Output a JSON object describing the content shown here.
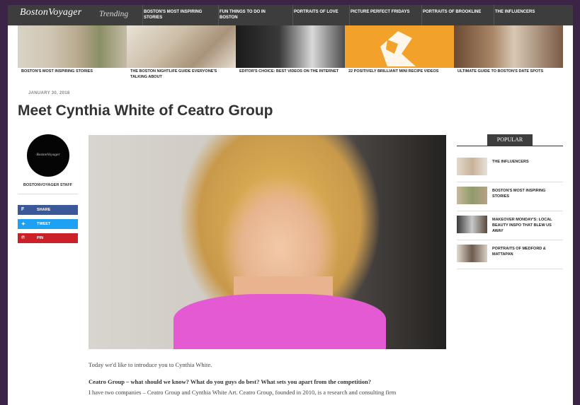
{
  "header": {
    "logo": "BostonVoyager",
    "trending_label": "Trending",
    "nav": [
      "BOSTON'S MOST INSPIRING STORIES",
      "FUN THINGS TO DO IN BOSTON",
      "PORTRAITS OF LOVE",
      "PICTURE PERFECT FRIDAYS",
      "PORTRAITS OF BROOKLINE",
      "THE INFLUENCERS"
    ]
  },
  "featured": [
    {
      "caption": "BOSTON'S MOST INSPIRING STORIES"
    },
    {
      "caption": "THE BOSTON NIGHTLIFE GUIDE EVERYONE'S TALKING ABOUT"
    },
    {
      "caption": "EDITOR'S CHOICE: BEST VIDEOS ON THE INTERNET"
    },
    {
      "caption": "22 POSITIVELY BRILLIANT MINI RECIPE VIDEOS"
    },
    {
      "caption": "ULTIMATE GUIDE TO BOSTON'S DATE SPOTS"
    }
  ],
  "article": {
    "date": "JANUARY 30, 2018",
    "title": "Meet Cynthia White of Ceatro Group",
    "author_logo": "BostonVoyager",
    "author": "BOSTONVOYAGER STAFF",
    "intro": "Today we'd like to introduce you to Cynthia White.",
    "question": "Ceatro Group – what should we know? What do you guys do best? What sets you apart from the competition?",
    "answer": "I have two companies – Ceatro Group and Cynthia White Art.  Ceatro Group, founded in 2010, is a research and consulting firm"
  },
  "share": {
    "facebook_label": "SHARE",
    "twitter_label": "TWEET",
    "pinterest_label": "PIN",
    "facebook_color": "#3b5998",
    "twitter_color": "#1da1f2",
    "pinterest_color": "#cb2027"
  },
  "popular": {
    "heading": "POPULAR",
    "items": [
      {
        "title": "THE INFLUENCERS"
      },
      {
        "title": "BOSTON'S MOST INSPIRING STORIES"
      },
      {
        "title": "MAKEOVER MONDAY'S: LOCAL BEAUTY INSPO THAT BLEW US AWAY"
      },
      {
        "title": "PORTRAITS OF MEDFORD & MATTAPAN"
      }
    ]
  }
}
